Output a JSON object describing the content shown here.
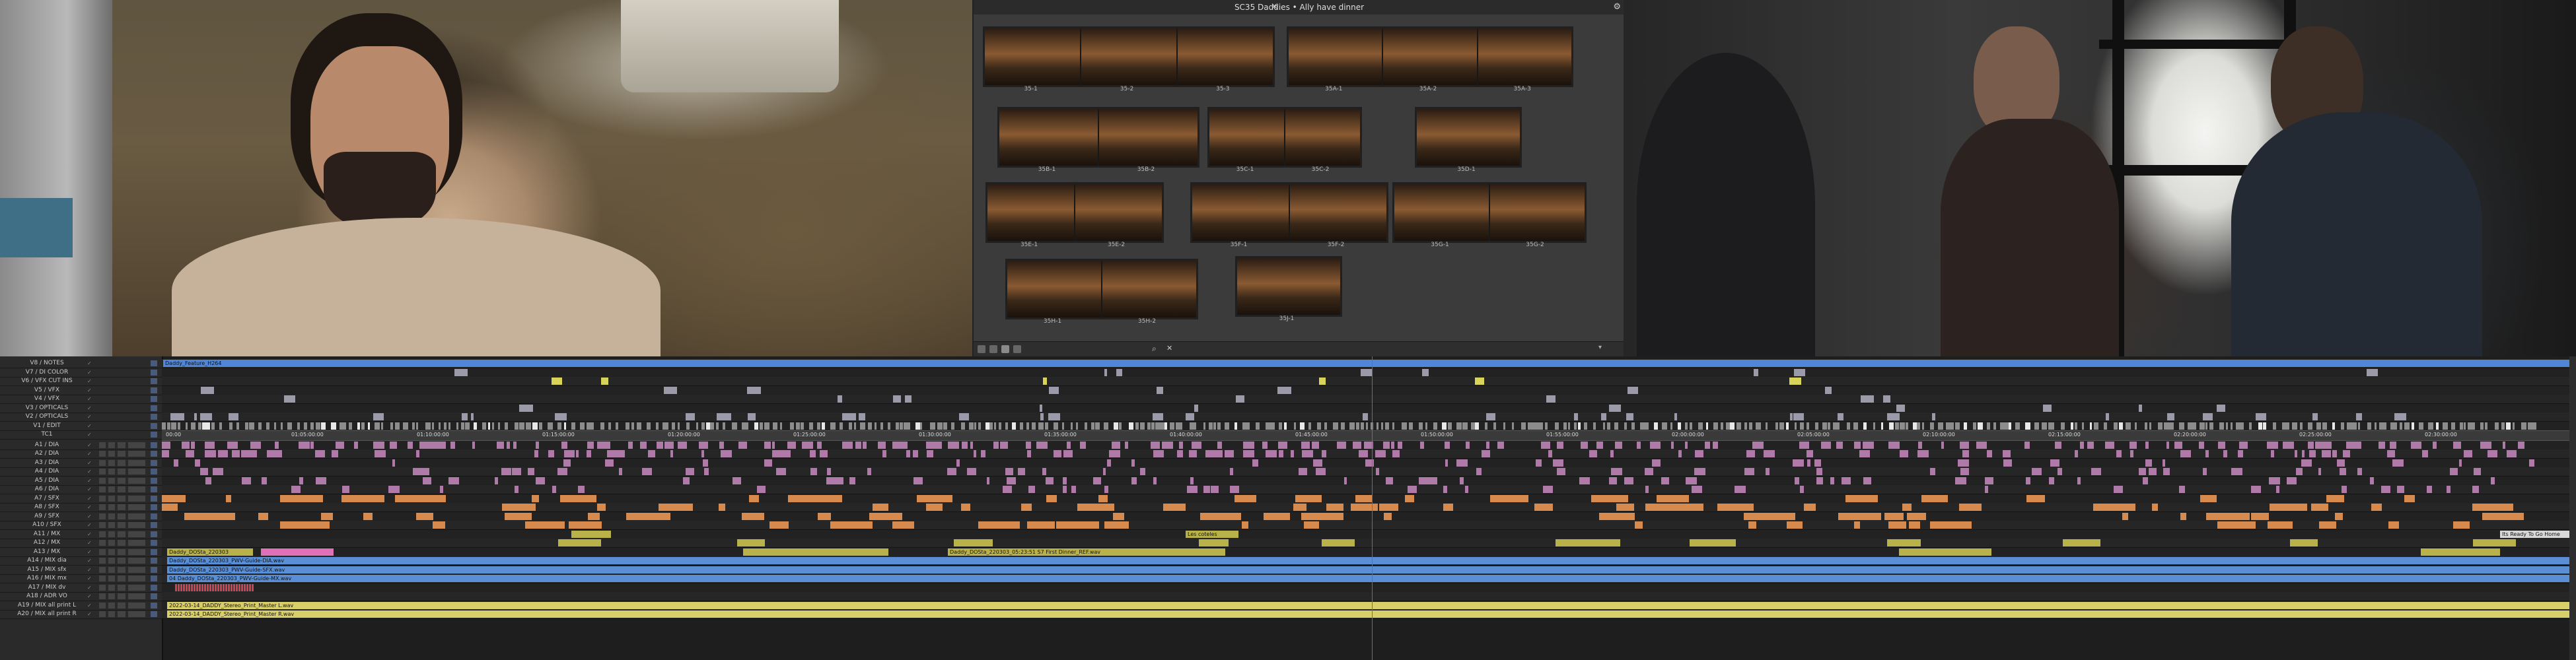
{
  "bin": {
    "title": "SC35 Daddies • Ally have dinner",
    "clip_groups": [
      {
        "labels": [
          "35-1",
          "35-2",
          "35-3"
        ]
      },
      {
        "labels": [
          "35A-1",
          "35A-2",
          "35A-3"
        ]
      },
      {
        "labels": [
          "35B-1",
          "35B-2"
        ]
      },
      {
        "labels": [
          "35C-1",
          "35C-2"
        ]
      },
      {
        "labels": [
          "35D-1"
        ]
      },
      {
        "labels": [
          "35E-1",
          "35E-2"
        ]
      },
      {
        "labels": [
          "35F-1",
          "35F-2"
        ]
      },
      {
        "labels": [
          "35G-1",
          "35G-2"
        ]
      },
      {
        "labels": [
          "35H-1",
          "35H-2"
        ]
      },
      {
        "labels": [
          "35J-1"
        ]
      }
    ]
  },
  "timeline": {
    "tracks": [
      "V8 / NOTES",
      "V7 / DI COLOR",
      "V6 / VFX CUT INS",
      "V5 / VFX",
      "V4 / VFX",
      "V3 / OPTICALS",
      "V2 / OPTICALS",
      "V1 / EDIT",
      "TC1",
      "A1 / DIA",
      "A2 / DIA",
      "A3 / DIA",
      "A4 / DIA",
      "A5 / DIA",
      "A6 / DIA",
      "A7 / SFX",
      "A8 / SFX",
      "A9 / SFX",
      "A10 / SFX",
      "A11 / MX",
      "A12 / MX",
      "A13 / MX",
      "A14 / MIX dia",
      "A15 / MIX sfx",
      "A16 / MIX mx",
      "A17 / MIX dv",
      "A18 / ADR VO",
      "A19 / MIX all print L",
      "A20 / MIX all print R"
    ],
    "clips": {
      "sequence": "Daddy_Feature_H264",
      "a12": "Daddy_DOSta_220303",
      "a13_main": "Daddy_DOSta_220303_05:23:51 S7 First Dinner_REF.wav",
      "a14": "Daddy_DOSta_220303_PWV-Guide-DIA.wav",
      "a15": "Daddy_DOSta_220303_PWV-Guide-SFX.wav",
      "a16": "04 Daddy_DOSta_220303_PWV-Guide-MX.wav",
      "a19": "2022-03-14_DADDY_Stereo_Print_Master L.wav",
      "a20": "2022-03-14_DADDY_Stereo_Print_Master R.wav",
      "a11_end": "Its Ready To Go Home",
      "a11_mid": "Les coteles"
    },
    "timecodes": [
      "00:00",
      "01:05:00:00",
      "01:10:00:00",
      "01:15:00:00",
      "01:20:00:00",
      "01:25:00:00",
      "01:30:00:00",
      "01:35:00:00",
      "01:40:00:00",
      "01:45:00:00",
      "01:50:00:00",
      "01:55:00:00",
      "02:00:00:00",
      "02:05:00:00",
      "02:10:00:00",
      "02:15:00:00",
      "02:20:00:00",
      "02:25:00:00",
      "02:30:00:00"
    ]
  },
  "colors": {
    "v1_clip": "#8c8c8c",
    "audio_dia": "#b07aa8",
    "audio_sfx": "#d68a4e",
    "audio_mx": "#b9b24a",
    "mix_track": "#5a8fd6",
    "print_track": "#d9cf6a",
    "sequence_bar": "#4f86d8"
  }
}
